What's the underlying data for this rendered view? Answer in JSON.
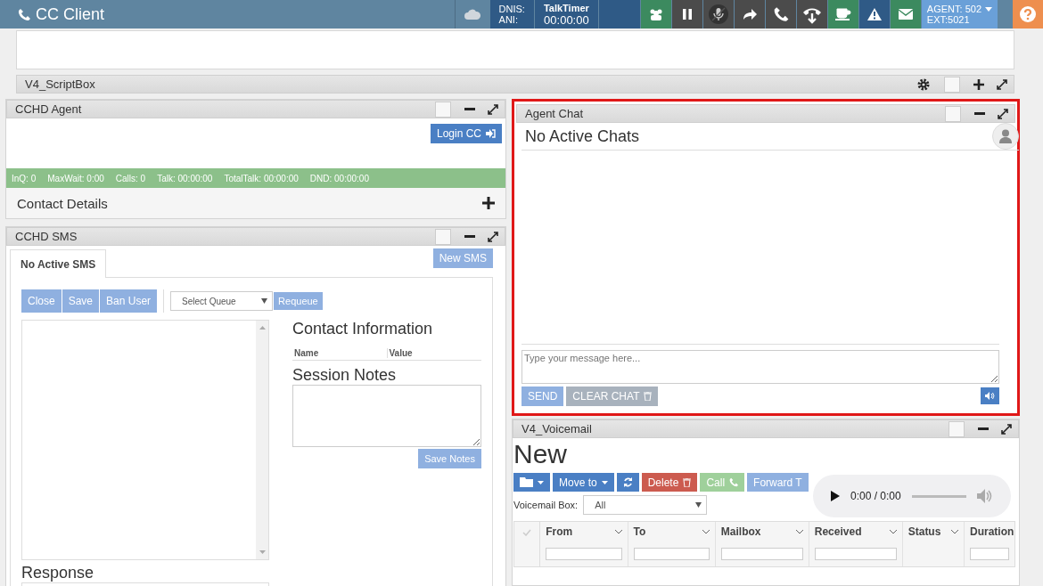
{
  "topbar": {
    "title": "CC Client",
    "dnis_label": "DNIS:",
    "ani_label": "ANI:",
    "timer_label": "TalkTimer",
    "timer": "00:00:00",
    "agent": "AGENT: 502",
    "ext": "EXT:5021"
  },
  "scriptbox": {
    "title": "V4_ScriptBox",
    "checked": false
  },
  "agent_panel": {
    "title": "CCHD Agent",
    "checked": false,
    "login_button": "Login CC",
    "stats": [
      "InQ: 0",
      "MaxWait: 0:00",
      "Calls: 0",
      "Talk: 00:00:00",
      "TotalTalk: 00:00:00",
      "DND: 00:00:00"
    ],
    "contact_details": "Contact Details"
  },
  "sms_panel": {
    "title": "CCHD SMS",
    "checked": false,
    "tabs": [
      {
        "label": "No Active SMS",
        "selected": true
      }
    ],
    "new_button": "New SMS",
    "actions": [
      "Close",
      "Save",
      "Ban User"
    ],
    "queue_select": "Select Queue",
    "requeue_button": "Requeue",
    "contact_heading": "Contact Information",
    "columns": [
      "Name",
      "Value"
    ],
    "notes_heading": "Session Notes",
    "save_notes": "Save Notes",
    "response_heading": "Response"
  },
  "chat_panel": {
    "title": "Agent Chat",
    "checked": false,
    "status": "No Active Chats",
    "placeholder": "Type your message here...",
    "send": "SEND",
    "clear": "CLEAR CHAT"
  },
  "voicemail": {
    "title": "V4_Voicemail",
    "checked": false,
    "heading": "New",
    "buttons": [
      {
        "label": "Move to",
        "kind": "menu",
        "color": "#4a7fc4"
      },
      {
        "label": "Delete",
        "kind": "delete",
        "color": "#cc5b4f"
      },
      {
        "label": "Call",
        "kind": "call",
        "color": "#9fd09b"
      },
      {
        "label": "Forward T",
        "kind": "plain",
        "color": "#8fb0e0"
      }
    ],
    "box_label": "Voicemail Box:",
    "box_value": "All",
    "player_time": "0:00 / 0:00",
    "columns": [
      {
        "label": "From",
        "filter": true
      },
      {
        "label": "To",
        "filter": true
      },
      {
        "label": "Mailbox",
        "filter": true
      },
      {
        "label": "Received",
        "filter": true
      },
      {
        "label": "Status",
        "filter": false
      },
      {
        "label": "Duration",
        "filter": true
      }
    ]
  }
}
